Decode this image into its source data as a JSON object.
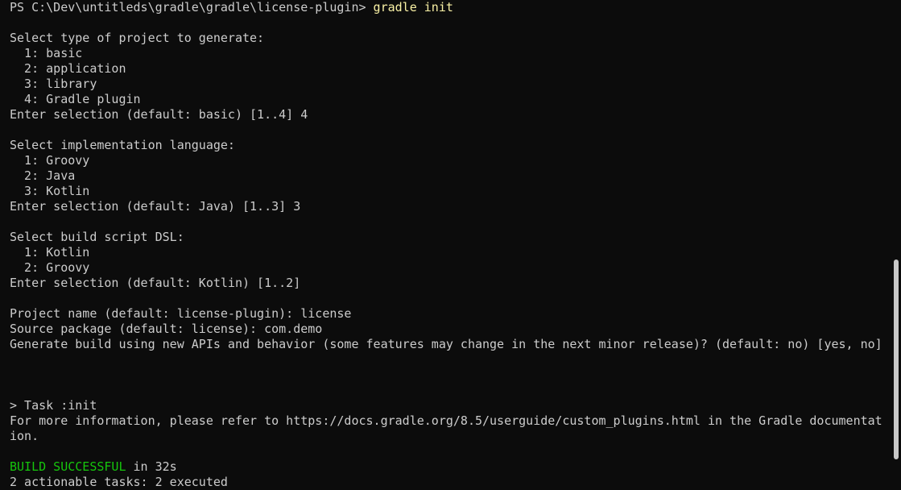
{
  "prompt": {
    "ps_path": "PS C:\\Dev\\untitleds\\gradle\\gradle\\license-plugin> ",
    "command": "gradle init"
  },
  "project_type": {
    "heading": "Select type of project to generate:",
    "options": [
      "  1: basic",
      "  2: application",
      "  3: library",
      "  4: Gradle plugin"
    ],
    "prompt": "Enter selection (default: basic) [1..4] 4"
  },
  "language": {
    "heading": "Select implementation language:",
    "options": [
      "  1: Groovy",
      "  2: Java",
      "  3: Kotlin"
    ],
    "prompt": "Enter selection (default: Java) [1..3] 3"
  },
  "dsl": {
    "heading": "Select build script DSL:",
    "options": [
      "  1: Kotlin",
      "  2: Groovy"
    ],
    "prompt": "Enter selection (default: Kotlin) [1..2]"
  },
  "questions": {
    "project_name": "Project name (default: license-plugin): license",
    "source_package": "Source package (default: license): com.demo",
    "new_apis": "Generate build using new APIs and behavior (some features may change in the next minor release)? (default: no) [yes, no]"
  },
  "task": {
    "header": "> Task :init",
    "info_line1": "For more information, please refer to https://docs.gradle.org/8.5/userguide/custom_plugins.html in the Gradle documentat",
    "info_line2": "ion."
  },
  "result": {
    "status": "BUILD SUCCESSFUL",
    "time": " in 32s",
    "partial_line": "2 actionable tasks: 2 executed"
  },
  "colors": {
    "background": "#0c0c0c",
    "text": "#cccccc",
    "command": "#f9f1a5",
    "success": "#16c60c"
  }
}
